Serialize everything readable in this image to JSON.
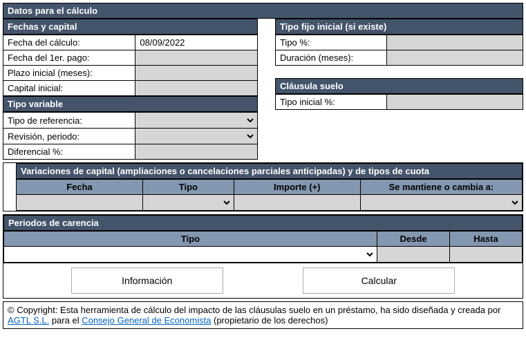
{
  "main_title": "Datos para el cálculo",
  "fechas": {
    "title": "Fechas y capital",
    "fecha_calculo_lbl": "Fecha del cálculo:",
    "fecha_calculo_val": "08/09/2022",
    "fecha_1er_pago_lbl": "Fecha del 1er. pago:",
    "fecha_1er_pago_val": "",
    "plazo_lbl": "Plazo inicial (meses):",
    "plazo_val": "",
    "capital_lbl": "Capital inicial:",
    "capital_val": ""
  },
  "tipo_variable": {
    "title": "Tipo variable",
    "referencia_lbl": "Tipo de referencia:",
    "revision_lbl": "Revisión, periodo:",
    "diferencial_lbl": "Diferencial %:"
  },
  "tipo_fijo": {
    "title": "Tipo fijo inicial (si existe)",
    "tipo_lbl": "Tipo %:",
    "tipo_val": "",
    "duracion_lbl": "Duración (meses):",
    "duracion_val": ""
  },
  "clausula": {
    "title": "Cláusula suelo",
    "tipo_inicial_lbl": "Tipo inicial %:",
    "tipo_inicial_val": ""
  },
  "variaciones": {
    "title": "Variaciones de capital (ampliaciones o cancelaciones parciales anticipadas) y de tipos de cuota",
    "col_fecha": "Fecha",
    "col_tipo": "Tipo",
    "col_importe": "Importe (+)",
    "col_mantiene": "Se mantiene o cambia a:"
  },
  "carencia": {
    "title": "Periodos de carencia",
    "col_tipo": "Tipo",
    "col_desde": "Desde",
    "col_hasta": "Hasta"
  },
  "buttons": {
    "info": "Información",
    "calc": "Calcular"
  },
  "footer": {
    "pre": "© Copyright: Esta herramienta de cálculo del impacto de las cláusulas suelo en un préstamo, ha sido diseñada y creada por ",
    "link1": "AGTL S.L.",
    "mid": " para el ",
    "link2": "Consejo General de Economista",
    "post": " (propietario de los derechos)"
  }
}
